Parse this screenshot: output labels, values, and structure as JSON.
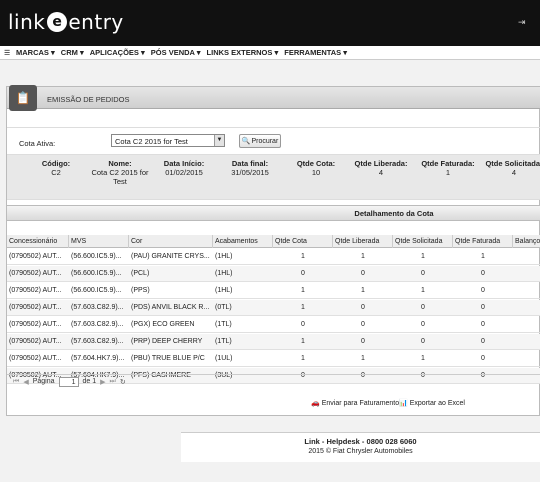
{
  "brand": {
    "logo_pre": "link",
    "logo_e": "e",
    "logo_post": "entry"
  },
  "menu": {
    "items": [
      "MARCAS",
      "CRM",
      "APLICAÇÕES",
      "PÓS VENDA",
      "LINKS EXTERNOS",
      "FERRAMENTAS"
    ]
  },
  "panel": {
    "title": "EMISSÃO DE PEDIDOS"
  },
  "filter": {
    "cota_label": "Cota Ativa:",
    "cota_value": "Cota C2 2015 for Test",
    "search_button": "Procurar"
  },
  "summary": {
    "codigo_label": "Código:",
    "codigo": "C2",
    "nome_label": "Nome:",
    "nome_l1": "Cota C2 2015 for",
    "nome_l2": "Test",
    "inicio_label": "Data Início:",
    "inicio": "01/02/2015",
    "final_label": "Data final:",
    "final": "31/05/2015",
    "qtde_cota_label": "Qtde Cota:",
    "qtde_cota": "10",
    "qtde_liberada_label": "Qtde Liberada:",
    "qtde_liberada": "4",
    "qtde_faturada_label": "Qtde Faturada:",
    "qtde_faturada": "1",
    "qtde_solicitada_label": "Qtde Solicitada:",
    "qtde_solicitada": "4"
  },
  "grid": {
    "title": "Detalhamento da Cota",
    "columns": [
      "Concessionário",
      "MVS",
      "Cor",
      "Acabamentos",
      "Qtde Cota",
      "Qtde Liberada",
      "Qtde Solicitada",
      "Qtde Faturada",
      "Balanço"
    ],
    "rows": [
      [
        "(0790502) AUT...",
        "(56.600.IC5.9)...",
        "(PAU) GRANITE CRYS...",
        "(1HL)",
        "1",
        "1",
        "1",
        "1"
      ],
      [
        "(0790502) AUT...",
        "(56.600.IC5.9)...",
        "(PCL)",
        "(1HL)",
        "0",
        "0",
        "0",
        "0"
      ],
      [
        "(0790502) AUT...",
        "(56.600.IC5.9)...",
        "(PPS)",
        "(1HL)",
        "1",
        "1",
        "1",
        "0"
      ],
      [
        "(0790502) AUT...",
        "(57.603.C82.9)...",
        "(PDS) ANVIL BLACK R...",
        "(0TL)",
        "1",
        "0",
        "0",
        "0"
      ],
      [
        "(0790502) AUT...",
        "(57.603.C82.9)...",
        "(PGX) ECO GREEN",
        "(1TL)",
        "0",
        "0",
        "0",
        "0"
      ],
      [
        "(0790502) AUT...",
        "(57.603.C82.9)...",
        "(PRP) DEEP CHERRY",
        "(1TL)",
        "1",
        "0",
        "0",
        "0"
      ],
      [
        "(0790502) AUT...",
        "(57.604.HK7.9)...",
        "(PBU) TRUE BLUE P/C",
        "(1UL)",
        "1",
        "1",
        "1",
        "0"
      ],
      [
        "(0790502) AUT...",
        "(57.604.HK7.9)...",
        "(PFS) CASHMERE",
        "(3UL)",
        "0",
        "0",
        "0",
        "0"
      ]
    ]
  },
  "pager": {
    "page_label": "Página",
    "page_value": "1",
    "of_label": "de 1"
  },
  "actions": {
    "send": "Enviar para Faturamento",
    "export": "Exportar ao Excel"
  },
  "footer": {
    "line1": "Link - Helpdesk - 0800 028 6060",
    "line2": "2015 © Fiat Chrysler Automobiles"
  }
}
